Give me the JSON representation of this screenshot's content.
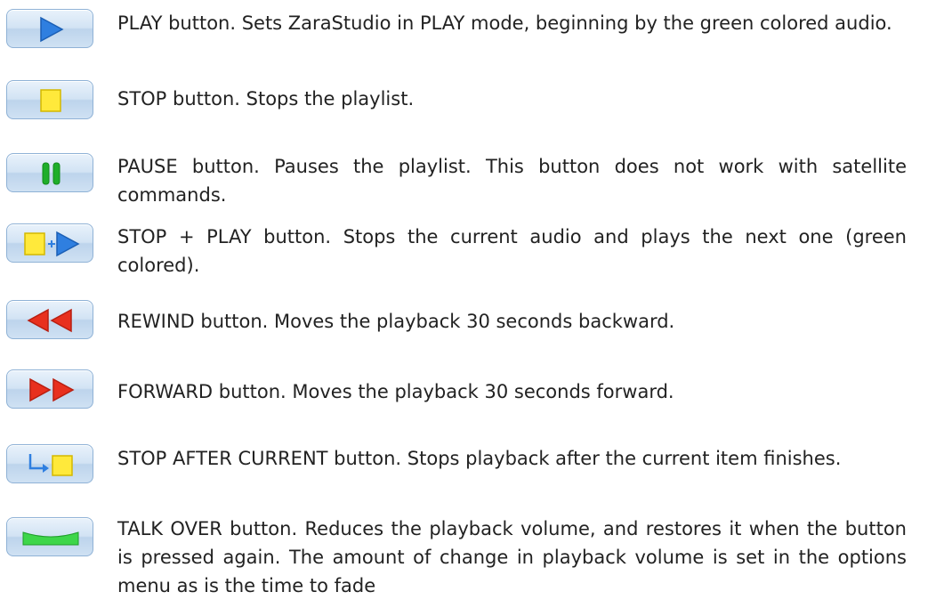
{
  "buttons": [
    {
      "icon": "play-icon",
      "text": "PLAY button. Sets ZaraStudio in PLAY mode, beginning by the green colored audio."
    },
    {
      "icon": "stop-icon",
      "text": "STOP button. Stops the playlist."
    },
    {
      "icon": "pause-icon",
      "text": "PAUSE button. Pauses the playlist. This button does not work with satellite commands."
    },
    {
      "icon": "stop-play-icon",
      "text": "STOP + PLAY button. Stops the current audio and plays the next one (green colored)."
    },
    {
      "icon": "rewind-icon",
      "text": "REWIND button. Moves the playback 30 seconds backward."
    },
    {
      "icon": "forward-icon",
      "text": "FORWARD button. Moves the playback 30 seconds forward."
    },
    {
      "icon": "stop-after-current-icon",
      "text": "STOP AFTER CURRENT button. Stops playback after the current item finishes."
    },
    {
      "icon": "talk-over-icon",
      "text": "TALK OVER button. Reduces the playback volume, and restores it when the button is pressed again. The amount of change in playback volume is set in the options menu as is the time to fade"
    }
  ]
}
